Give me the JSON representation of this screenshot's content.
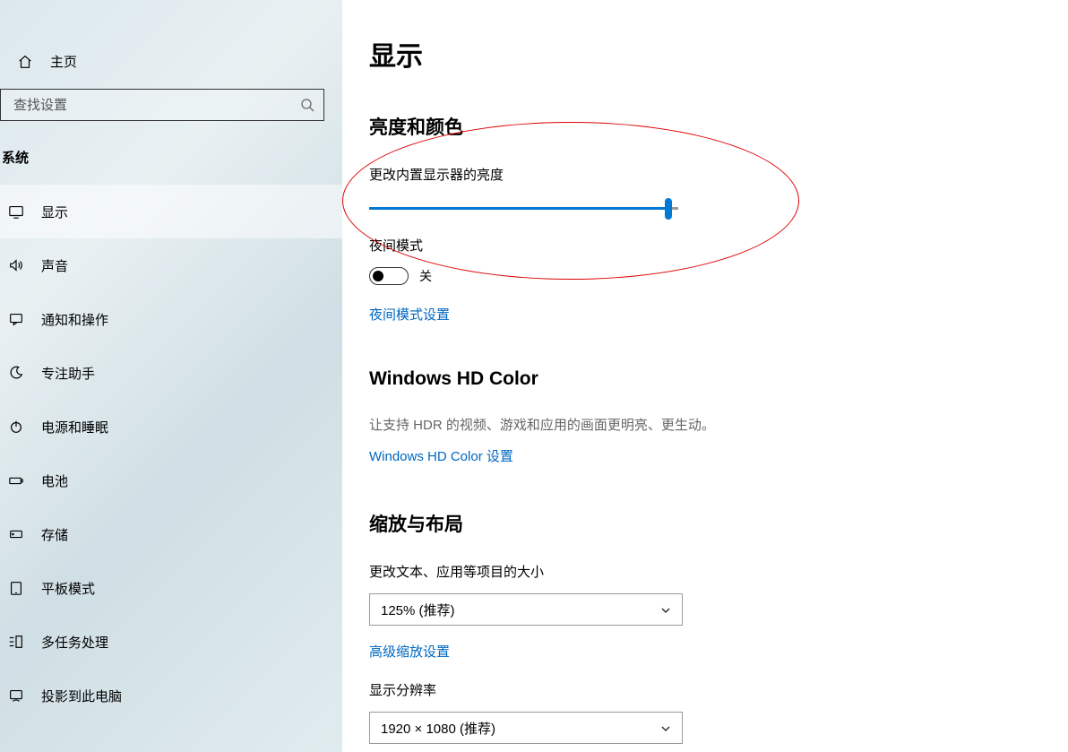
{
  "sidebar": {
    "home_label": "主页",
    "search_placeholder": "查找设置",
    "section_label": "系统",
    "items": [
      {
        "label": "显示"
      },
      {
        "label": "声音"
      },
      {
        "label": "通知和操作"
      },
      {
        "label": "专注助手"
      },
      {
        "label": "电源和睡眠"
      },
      {
        "label": "电池"
      },
      {
        "label": "存储"
      },
      {
        "label": "平板模式"
      },
      {
        "label": "多任务处理"
      },
      {
        "label": "投影到此电脑"
      }
    ]
  },
  "main": {
    "title": "显示",
    "brightness": {
      "heading": "亮度和颜色",
      "slider_label": "更改内置显示器的亮度",
      "night_mode_label": "夜间模式",
      "night_mode_state": "关",
      "night_mode_settings_link": "夜间模式设置"
    },
    "hdcolor": {
      "heading": "Windows HD Color",
      "desc": "让支持 HDR 的视频、游戏和应用的画面更明亮、更生动。",
      "link": "Windows HD Color 设置"
    },
    "scale": {
      "heading": "缩放与布局",
      "text_size_label": "更改文本、应用等项目的大小",
      "text_size_value": "125% (推荐)",
      "advanced_link": "高级缩放设置",
      "resolution_label": "显示分辨率",
      "resolution_value": "1920 × 1080 (推荐)"
    }
  }
}
